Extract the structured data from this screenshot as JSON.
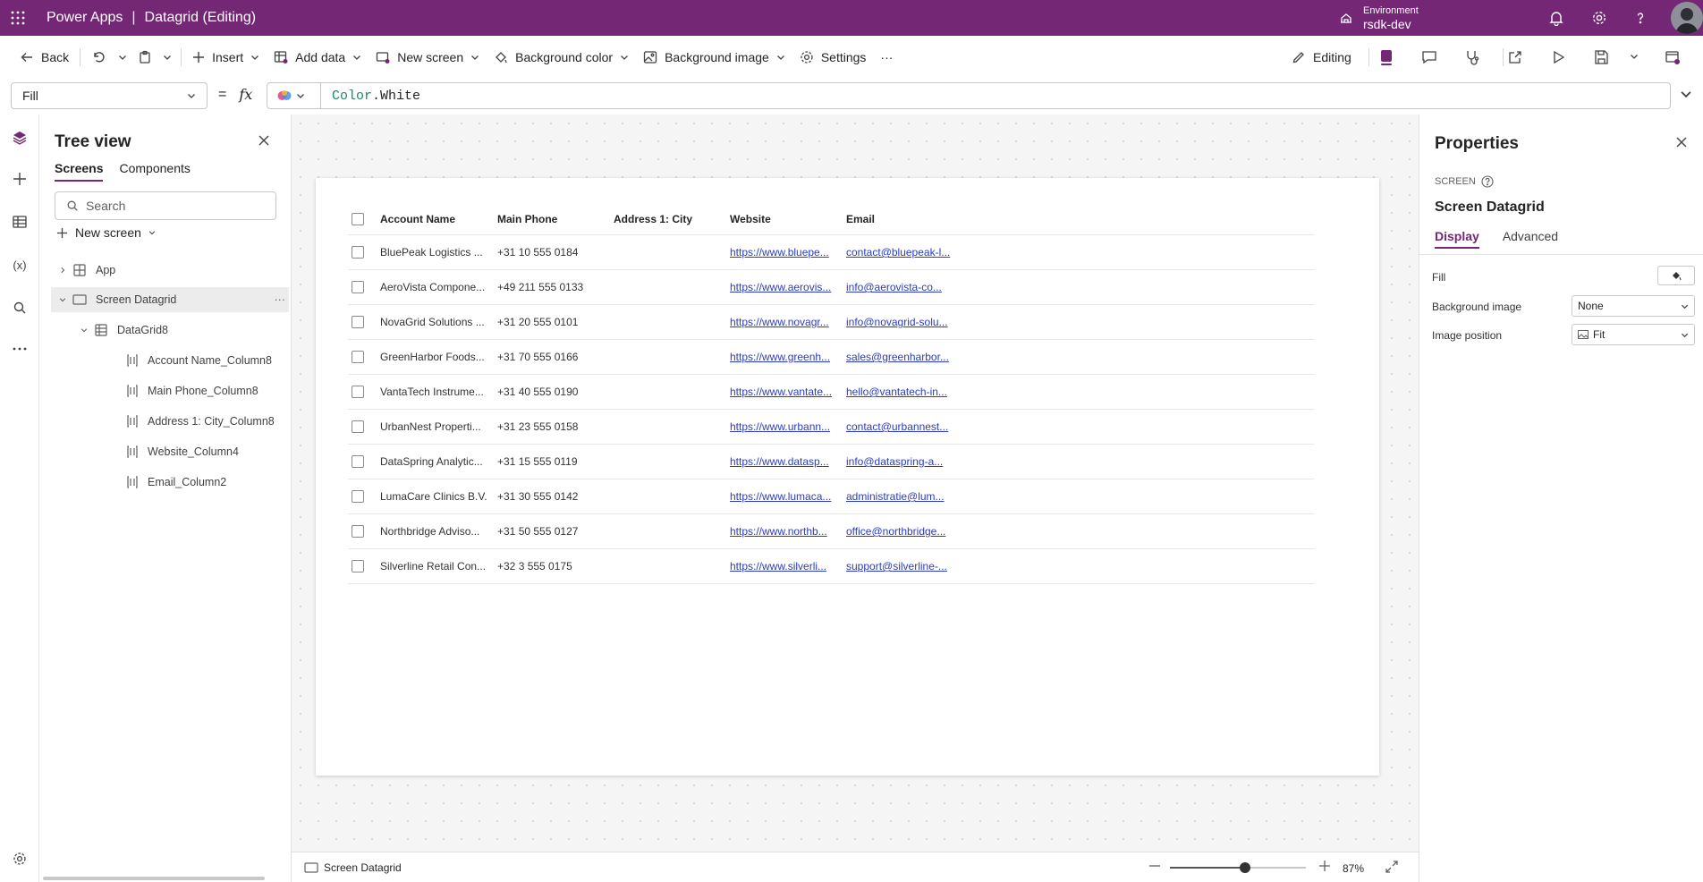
{
  "app": {
    "name": "Power Apps",
    "separator": "|",
    "document": "Datagrid (Editing)"
  },
  "environment": {
    "label": "Environment",
    "value": "rsdk-dev"
  },
  "toolbar": {
    "back": "Back",
    "insert": "Insert",
    "add_data": "Add data",
    "new_screen": "New screen",
    "background_color": "Background color",
    "background_image": "Background image",
    "settings": "Settings",
    "more": "···",
    "editing": "Editing"
  },
  "formula_bar": {
    "property": "Fill",
    "equals": "=",
    "fx": "fx",
    "keyword": "Color",
    "member": ".White"
  },
  "tree_view": {
    "title": "Tree view",
    "tabs": [
      "Screens",
      "Components"
    ],
    "search_placeholder": "Search",
    "new_screen": "New screen",
    "nodes": [
      {
        "label": "App"
      },
      {
        "label": "Screen Datagrid"
      },
      {
        "label": "DataGrid8"
      },
      {
        "label": "Account Name_Column8"
      },
      {
        "label": "Main Phone_Column8"
      },
      {
        "label": "Address 1: City_Column8"
      },
      {
        "label": "Website_Column4"
      },
      {
        "label": "Email_Column2"
      }
    ]
  },
  "datagrid": {
    "columns": [
      "Account Name",
      "Main Phone",
      "Address 1: City",
      "Website",
      "Email"
    ],
    "rows": [
      [
        "BluePeak Logistics ...",
        "+31 10 555 0184",
        "",
        "https://www.bluepe...",
        "contact@bluepeak-l..."
      ],
      [
        "AeroVista Compone...",
        "+49 211 555 0133",
        "",
        "https://www.aerovis...",
        "info@aerovista-co..."
      ],
      [
        "NovaGrid Solutions ...",
        "+31 20 555 0101",
        "",
        "https://www.novagr...",
        "info@novagrid-solu..."
      ],
      [
        "GreenHarbor Foods...",
        "+31 70 555 0166",
        "",
        "https://www.greenh...",
        "sales@greenharbor..."
      ],
      [
        "VantaTech Instrume...",
        "+31 40 555 0190",
        "",
        "https://www.vantate...",
        "hello@vantatech-in..."
      ],
      [
        "UrbanNest Properti...",
        "+31 23 555 0158",
        "",
        "https://www.urbann...",
        "contact@urbannest..."
      ],
      [
        "DataSpring Analytic...",
        "+31 15 555 0119",
        "",
        "https://www.datasp...",
        "info@dataspring-a..."
      ],
      [
        "LumaCare Clinics B.V.",
        "+31 30 555 0142",
        "",
        "https://www.lumaca...",
        "administratie@lum..."
      ],
      [
        "Northbridge Adviso...",
        "+31 50 555 0127",
        "",
        "https://www.northb...",
        "office@northbridge..."
      ],
      [
        "Silverline Retail Con...",
        "+32 3 555 0175",
        "",
        "https://www.silverli...",
        "support@silverline-..."
      ]
    ]
  },
  "status_bar": {
    "screen_name": "Screen Datagrid",
    "zoom": "87%",
    "zoom_fraction": 0.55
  },
  "properties": {
    "title": "Properties",
    "type": "SCREEN",
    "name": "Screen Datagrid",
    "tabs": [
      "Display",
      "Advanced"
    ],
    "fill_label": "Fill",
    "background_image_label": "Background image",
    "background_image_value": "None",
    "image_position_label": "Image position",
    "image_position_value": "Fit"
  },
  "colors": {
    "brand": "#742774",
    "link": "#2b3cc4",
    "canvas": "#f5f5f5"
  }
}
